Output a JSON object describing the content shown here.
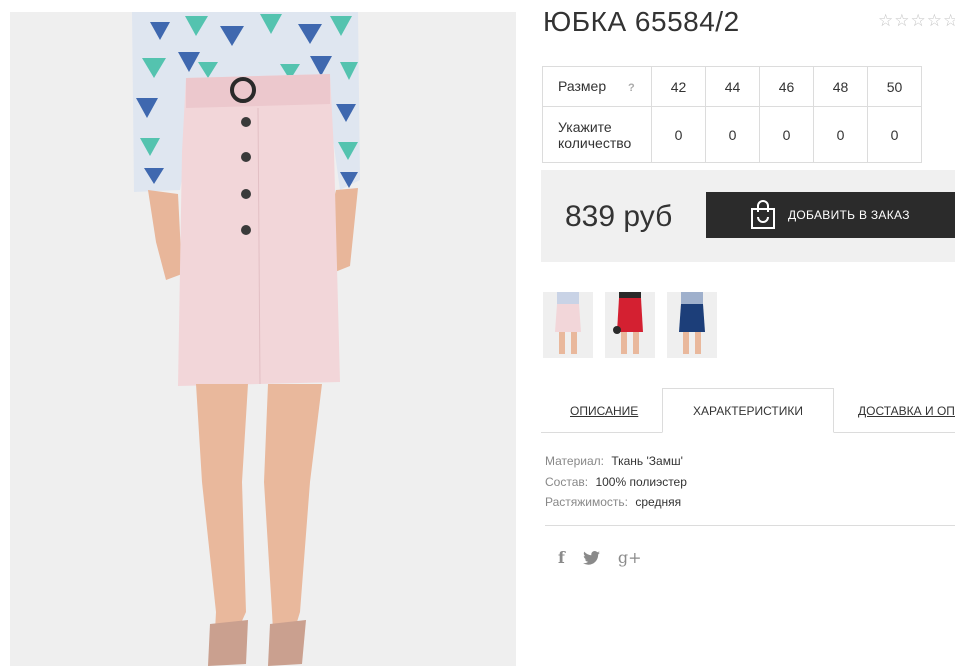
{
  "product": {
    "title": "ЮБКА 65584/2",
    "rating_max": 5,
    "rating_value": 0
  },
  "sizes": {
    "row_label": "Размер",
    "help_label": "?",
    "qty_label": "Укажите количество",
    "values": [
      "42",
      "44",
      "46",
      "48",
      "50"
    ],
    "quantities": [
      "0",
      "0",
      "0",
      "0",
      "0"
    ]
  },
  "buy": {
    "price": "839 руб",
    "add_to_order": "ДОБАВИТЬ В ЗАКАЗ",
    "icon": "shopping-bag-icon"
  },
  "thumbnails": [
    {
      "color": "#f2d6d9",
      "label": "pink"
    },
    {
      "color": "#d42031",
      "label": "red"
    },
    {
      "color": "#1c3e79",
      "label": "navy"
    }
  ],
  "tabs": {
    "description": "ОПИСАНИЕ",
    "characteristics": "ХАРАКТЕРИСТИКИ",
    "delivery": "ДОСТАВКА И ОПЛАТА"
  },
  "specs": [
    {
      "key": "Материал:",
      "value": "Ткань 'Замш'"
    },
    {
      "key": "Состав:",
      "value": "100% полиэстер"
    },
    {
      "key": "Растяжимость:",
      "value": "средняя"
    }
  ],
  "social": {
    "facebook": "f",
    "twitter": "twitter-bird-icon",
    "googleplus": "g+"
  },
  "colors": {
    "accent_dark": "#2b2b2b",
    "price_bg": "#f0f0f0",
    "skirt_pink": "#f2d6d9",
    "border": "#dcdcdc"
  }
}
